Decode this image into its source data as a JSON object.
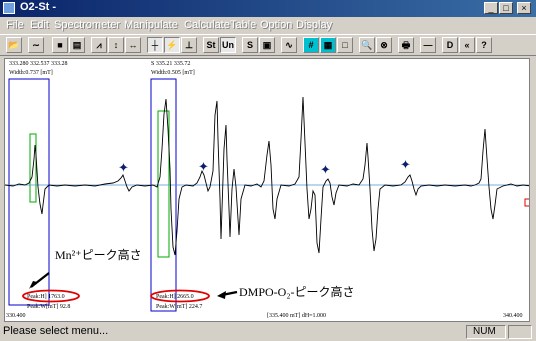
{
  "window": {
    "title": "O2-St -",
    "controls": [
      "_",
      "□",
      "×"
    ]
  },
  "menu": [
    "File",
    "Edit",
    "Spectrometer",
    "Manipulate",
    "Calculate",
    "Table",
    "Option",
    "Display"
  ],
  "toolbar": {
    "buttons": [
      {
        "icon": "open-icon",
        "glyph": "📂"
      },
      {
        "icon": "wave-icon",
        "glyph": "∼"
      },
      {
        "icon": "save-icon",
        "glyph": "■"
      },
      {
        "icon": "print-small-icon",
        "glyph": "▤"
      },
      {
        "icon": "zigzag-icon",
        "glyph": "⩘"
      },
      {
        "icon": "vertical-arrow-icon",
        "glyph": "↕"
      },
      {
        "icon": "horizontal-arrow-icon",
        "glyph": "↔"
      },
      {
        "icon": "cursor-pair-icon",
        "glyph": "┼"
      },
      {
        "icon": "peak-marker-icon",
        "glyph": "⚡"
      },
      {
        "icon": "peak-scale-icon",
        "glyph": "⊥"
      },
      {
        "icon": "st-button",
        "glyph": "St"
      },
      {
        "icon": "un-button",
        "glyph": "Un"
      },
      {
        "icon": "s-box-button",
        "glyph": "S"
      },
      {
        "icon": "clipboard-icon",
        "glyph": "▣"
      },
      {
        "icon": "derivative-icon",
        "glyph": "∿"
      },
      {
        "icon": "cross-grid-icon",
        "glyph": "#"
      },
      {
        "icon": "grid-icon",
        "glyph": "▦"
      },
      {
        "icon": "frame-icon",
        "glyph": "□"
      },
      {
        "icon": "zoom-icon",
        "glyph": "🔍"
      },
      {
        "icon": "zoom-x-icon",
        "glyph": "⊗"
      },
      {
        "icon": "printer-icon",
        "glyph": "🖶"
      },
      {
        "icon": "minus-icon",
        "glyph": "—"
      },
      {
        "icon": "d-icon",
        "glyph": "D"
      },
      {
        "icon": "double-chevron-icon",
        "glyph": "«"
      },
      {
        "icon": "help-icon",
        "glyph": "?"
      }
    ]
  },
  "readouts": {
    "left_range": "333.280 332.537 333.28",
    "left_width": "Width:0.737  [mT]",
    "right_range": "S  335.21 335.72",
    "right_width": "Width:0.505  [mT]",
    "left_peak": "Peak:H] 1763.0",
    "left_peak_w": "Peak:W[mT] 92.8",
    "right_peak": "Peak:H] 2665.0",
    "right_peak_w": "Peak:W[mT] 224.7",
    "axis_min": "330.400",
    "axis_center": "[335.400 mT]  dH=1.000",
    "axis_max": "340.400"
  },
  "annotations": {
    "mn_label": "Mn²⁺ピーク高さ",
    "dmpo_label": "DMPO-O₂-ピーク高さ"
  },
  "status": {
    "message": "Please select menu...",
    "num": "NUM"
  },
  "colors": {
    "titlebar": "#0a246a",
    "baseline": "#4a90d0",
    "cursor": "#0000cc",
    "highlight": "#00aa00",
    "marker": "#0b1f6e",
    "circle": "#e00000"
  }
}
